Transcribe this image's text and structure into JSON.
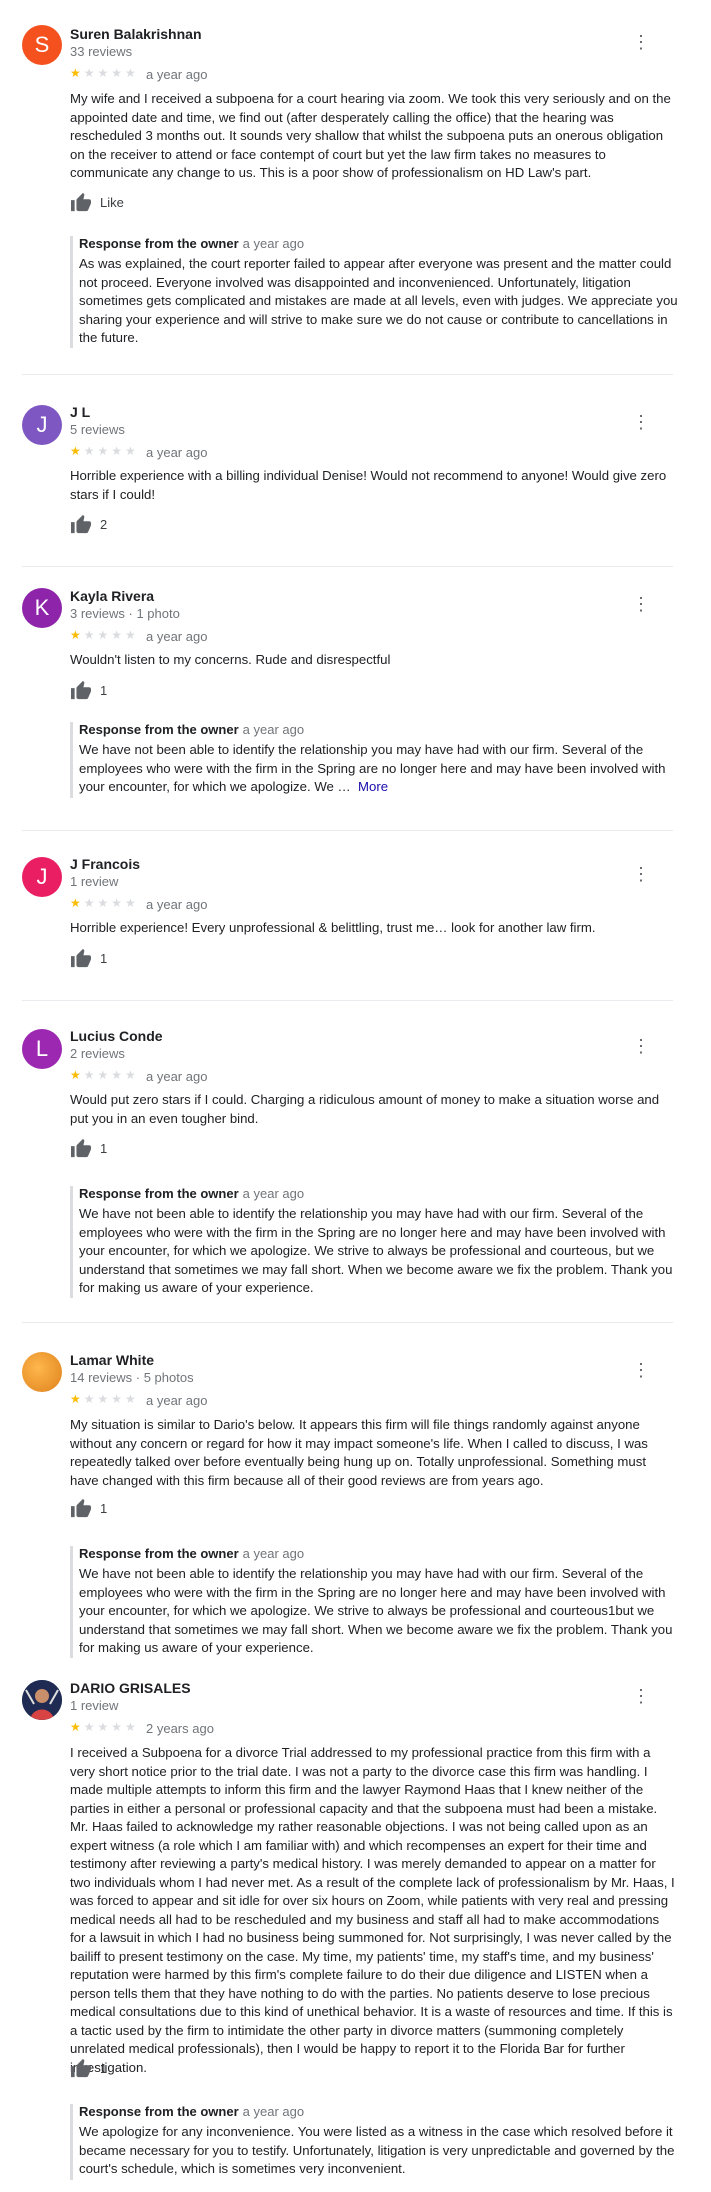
{
  "reviews": [
    {
      "initial": "S",
      "avatar_color": "#f4511e",
      "name": "Suren Balakrishnan",
      "meta": "33 reviews",
      "rating": 1,
      "date": "a year ago",
      "text": "My wife and I received a subpoena for a court hearing via zoom. We took this very seriously and on the appointed date and time, we find out (after desperately calling the office) that the hearing was rescheduled 3 months out. It sounds very shallow that whilst the subpoena puts an onerous obligation on the receiver to attend or face contempt of court but yet the law firm takes no measures to communicate any change to us. This is a poor show of professionalism on HD Law's part.",
      "like_label": "Like",
      "response": {
        "label": "Response from the owner",
        "date": "a year ago",
        "text": "As was explained, the court reporter failed to appear after everyone was present and the matter could not proceed. Everyone involved was disappointed and inconvenienced. Unfortunately, litigation sometimes gets complicated and mistakes are made at all levels, even with judges. We appreciate you sharing your experience and will strive to make sure we do not cause or contribute to cancellations in the future."
      }
    },
    {
      "initial": "J",
      "avatar_color": "#7e57c2",
      "name": "J L",
      "meta": "5 reviews",
      "rating": 1,
      "date": "a year ago",
      "text": "Horrible experience with a billing individual Denise! Would not recommend to anyone! Would give zero stars if I could!",
      "like_label": "2"
    },
    {
      "initial": "K",
      "avatar_color": "#8e24aa",
      "name": "Kayla Rivera",
      "meta": "3 reviews · 1 photo",
      "rating": 1,
      "date": "a year ago",
      "text": "Wouldn't listen to my concerns. Rude and disrespectful",
      "like_label": "1",
      "response": {
        "label": "Response from the owner",
        "date": "a year ago",
        "text": "We have not been able to identify the relationship you may have had with our firm. Several of the employees who were with the firm in the Spring are no longer here and may have been involved with your encounter, for which we apologize. We …",
        "more_label": "More"
      }
    },
    {
      "initial": "J",
      "avatar_color": "#e91e63",
      "name": "J Francois",
      "meta": "1 review",
      "rating": 1,
      "date": "a year ago",
      "text": "Horrible experience! Every unprofessional & belittling, trust me… look for another law firm.",
      "like_label": "1"
    },
    {
      "initial": "L",
      "avatar_color": "#9c27b0",
      "name": "Lucius Conde",
      "meta": "2 reviews",
      "rating": 1,
      "date": "a year ago",
      "text": "Would put zero stars if I could. Charging a ridiculous amount of money to make a situation worse and put you in an even tougher bind.",
      "like_label": "1",
      "response": {
        "label": "Response from the owner",
        "date": "a year ago",
        "text": "We have not been able to identify the relationship you may have had with our firm. Several of the employees who were with the firm in the Spring are no longer here and may have been involved with your encounter, for which we apologize. We strive to always be professional and courteous, but we understand that sometimes we may fall short. When we become aware we fix the problem. Thank you for making us aware of your experience."
      }
    },
    {
      "initial": "",
      "avatar_color": "#f2a541",
      "name": "Lamar White",
      "meta": "14 reviews · 5 photos",
      "rating": 1,
      "date": "a year ago",
      "text": "My situation is similar to Dario's below. It appears this firm will file things randomly against anyone without any concern or regard for how it may impact someone's life. When I called to discuss, I was repeatedly talked over before eventually being hung up on. Totally unprofessional. Something must have changed with this firm because all of their good reviews are from years ago.",
      "like_label": "1",
      "response": {
        "label": "Response from the owner",
        "date": "a year ago",
        "text": "We have not been able to identify the relationship you may have had with our firm. Several of the employees who were with the firm in the Spring are no longer here and may have been involved with your encounter, for which we apologize. We strive to always be professional and courteous1but we understand that sometimes we may fall short. When we become aware we fix the problem. Thank you for making us aware of your experience."
      }
    },
    {
      "initial": "",
      "avatar_color": "#2b3a67",
      "name": "DARIO GRISALES",
      "meta": "1 review",
      "rating": 1,
      "date": "2 years ago",
      "text": "I received a Subpoena for a divorce Trial addressed to my professional practice from this firm with a very short notice prior to the trial date. I was not a party to the divorce case this firm was handling. I made multiple attempts to inform this firm and the lawyer Raymond Haas that I knew neither of the parties in either a personal or professional capacity and that the subpoena must had been a mistake. Mr. Haas failed to acknowledge my rather reasonable objections. I was not being called upon as an expert witness (a role which I am familiar with) and which recompenses an expert for their time and testimony after reviewing a party's medical history. I was merely demanded to appear on a matter for two individuals whom I had never met. As a result of the complete lack of professionalism by Mr. Haas, I was forced to appear and sit idle for over six hours on Zoom, while patients with very real and pressing medical needs all had to be rescheduled and my business and staff all had to make accommodations for a lawsuit in which I had no business being summoned for. Not surprisingly, I was never called by the bailiff to present testimony on the case. My time, my patients' time, my staff's time, and my business' reputation were harmed by this firm's complete failure to do their due diligence and LISTEN when a person tells them that they have nothing to do with the parties. No patients deserve to lose precious medical consultations due to this kind of unethical behavior. It is a waste of resources and time. If this is a tactic used by the firm to intimidate the other party in divorce matters (summoning completely unrelated medical professionals), then I would be happy to report it to the Florida Bar for further investigation.",
      "like_label": "1",
      "response": {
        "label": "Response from the owner",
        "date": "a year ago",
        "text": "We apologize for any inconvenience. You were listed as a witness in the case which resolved before it became necessary for you to testify. Unfortunately, litigation is very unpredictable and governed by the court's schedule, which is sometimes very inconvenient."
      }
    }
  ]
}
